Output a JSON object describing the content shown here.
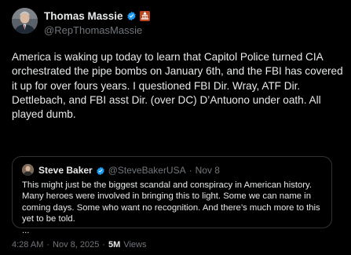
{
  "post": {
    "author": {
      "display_name": "Thomas Massie",
      "handle": "@RepThomasMassie",
      "verified_icon": "verified-badge-icon",
      "affiliation_icon": "us-capitol-badge-icon"
    },
    "text": "America is waking up today to learn that Capitol Police turned CIA orchestrated the pipe bombs on January 6th, and the FBI has covered it up for over fours years. I questioned FBI Dir. Wray, ATF Dir. Dettlebach, and FBI asst Dir. (over DC) D’Antuono under oath. All played dumb.",
    "quote": {
      "display_name": "Steve Baker",
      "handle": "@SteveBakerUSA",
      "separator": "·",
      "date": "Nov 8",
      "text": "This might just be the biggest scandal and conspiracy in American history. Many heroes were involved in bringing this to light. Some we can name in coming days. Some who want no recognition. And there’s much more to this yet to be told.\n...",
      "verified_icon": "verified-badge-icon"
    },
    "meta": {
      "time": "4:28 AM",
      "separator1": "·",
      "date": "Nov 8, 2025",
      "separator2": "·",
      "views_count": "5M",
      "views_label": "Views"
    }
  },
  "colors": {
    "background": "#000000",
    "text_primary": "#e7e9ea",
    "text_secondary": "#71767b",
    "verified_blue": "#1d9bf0",
    "border": "#2f3336"
  }
}
